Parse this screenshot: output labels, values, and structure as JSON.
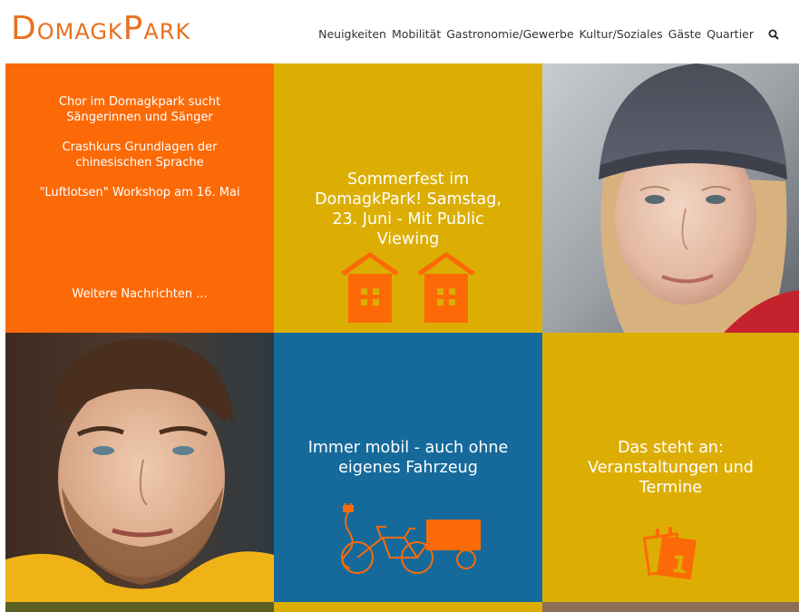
{
  "brand": {
    "logo_first_cap": "D",
    "logo_first_rest": "OMAGK",
    "logo_second_cap": "P",
    "logo_second_rest": "ARK",
    "accent": "#e8701e"
  },
  "nav": {
    "items": [
      {
        "label": "Neuigkeiten"
      },
      {
        "label": "Mobilität"
      },
      {
        "label": "Gastronomie/Gewerbe"
      },
      {
        "label": "Kultur/Soziales"
      },
      {
        "label": "Gäste"
      },
      {
        "label": "Quartier"
      }
    ],
    "search_icon": "search-icon"
  },
  "tiles": {
    "news": {
      "color": "#fc6a07",
      "items": [
        {
          "text": "Chor im Domagkpark sucht Sängerinnen und Sänger"
        },
        {
          "text": "Crashkurs Grundlagen der chinesischen Sprache"
        },
        {
          "text": "\"Luftlotsen\" Workshop am 16. Mai"
        }
      ],
      "more_label": "Weitere Nachrichten ..."
    },
    "summer": {
      "color": "#dcae04",
      "title": "Sommerfest im DomagkPark! Samstag, 23. Juni - Mit Public Viewing",
      "icon": "houses-icon"
    },
    "portrait_woman": {
      "icon": "portrait-woman"
    },
    "portrait_man": {
      "icon": "portrait-man"
    },
    "mobility": {
      "color": "#156a9b",
      "title": "Immer mobil - auch ohne eigenes Fahrzeug",
      "icon": "cargo-bike-icon"
    },
    "events": {
      "color": "#dcae04",
      "title": "Das steht an: Veranstaltungen und Termine",
      "icon": "calendar-icon"
    }
  }
}
